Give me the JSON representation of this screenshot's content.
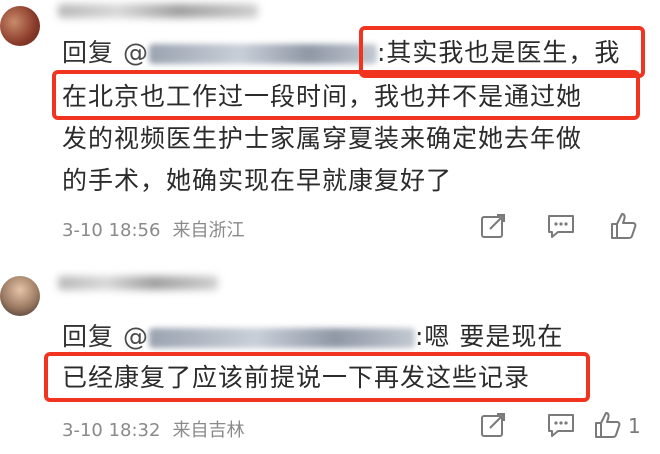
{
  "comments": [
    {
      "reply_prefix": "回复",
      "mention": "@",
      "lines": [
        ":其实我也是医生，我",
        "在北京也工作过一段时间，我也并不是通过她",
        "发的视频医生护士家属穿夏装来确定她去年做",
        "的手术，她确实现在早就康复好了"
      ],
      "time": "3-10 18:56",
      "location": "来自浙江",
      "actions": [
        "share-icon",
        "comment-icon",
        "like-icon"
      ],
      "like_count": ""
    },
    {
      "reply_prefix": "回复",
      "mention": "@",
      "lines": [
        ":嗯 要是现在",
        "已经康复了应该前提说一下再发这些记录"
      ],
      "time": "3-10 18:32",
      "location": "来自吉林",
      "actions": [
        "share-icon",
        "comment-icon",
        "like-icon"
      ],
      "like_count": "1"
    }
  ],
  "colors": {
    "highlight": "#f0341f",
    "text": "#2b2b2b",
    "meta": "#8a8a8a",
    "background": "#ffffff"
  }
}
